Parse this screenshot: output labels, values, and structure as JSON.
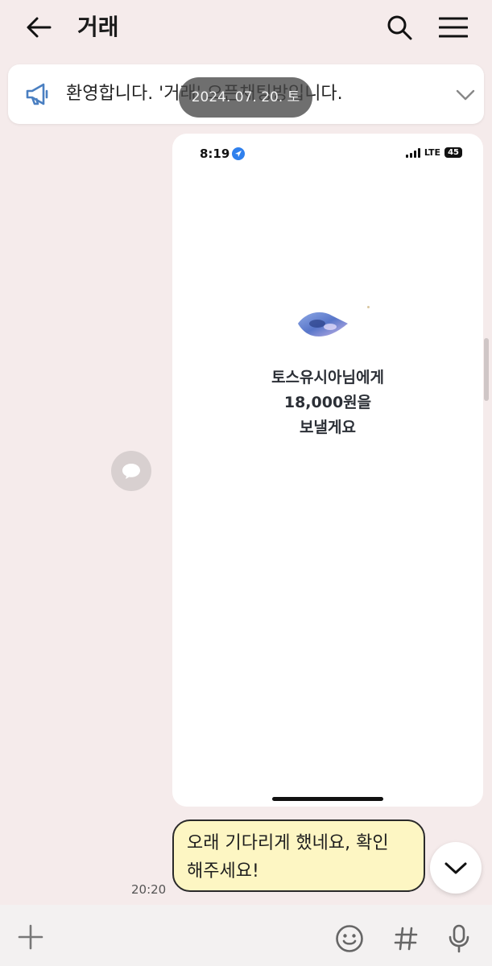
{
  "header": {
    "title": "거래",
    "back_icon": "arrow-left-icon",
    "search_icon": "search-icon",
    "menu_icon": "hamburger-menu-icon"
  },
  "notice": {
    "icon": "megaphone-icon",
    "text": "환영합니다. '거래' 오픈채팅방입니다."
  },
  "date_pill": "2024. 07. 20. 토",
  "shared_image": {
    "status_time": "8:19",
    "network": "LTE",
    "battery": "45",
    "lines": [
      "토스유시아님에게",
      "18,000원을",
      "보낼게요"
    ]
  },
  "message": {
    "line1": "오래 기다리게 했네요, 확인",
    "line2": "해주세요!",
    "time": "20:20"
  },
  "bottom_bar": {
    "plus_icon": "plus-icon",
    "emoji_icon": "emoji-icon",
    "hash_icon": "hashtag-icon",
    "mic_icon": "microphone-icon"
  },
  "colors": {
    "background": "#f5ebeb",
    "bubble": "#fdf6c3",
    "notice_icon": "#4a7fc1"
  }
}
